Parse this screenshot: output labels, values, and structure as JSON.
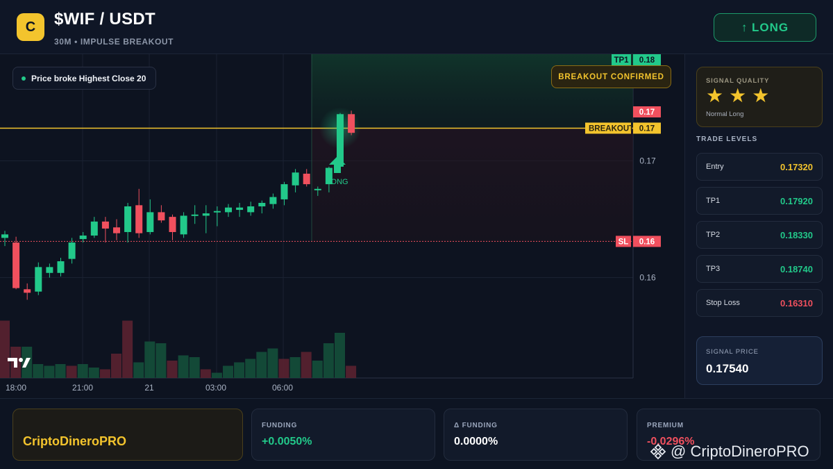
{
  "header": {
    "logo_letter": "C",
    "pair": "$WIF / USDT",
    "subtitle": "30M • IMPULSE BREAKOUT",
    "long_button": "↑ LONG"
  },
  "chart": {
    "signal_pill": "Price broke Highest Close 20",
    "confirm_badge": "BREAKOUT CONFIRMED",
    "long_marker_label": "LONG",
    "price_axis_labels": [
      "0.17",
      "0.16"
    ],
    "time_axis_labels": [
      "18:00",
      "21:00",
      "21",
      "03:00",
      "06:00"
    ],
    "tags": {
      "tp1_label": "TP1",
      "tp1_value": "0.18",
      "current_value": "0.17",
      "breakout_label": "BREAKOUT",
      "breakout_value": "0.17",
      "sl_label": "SL",
      "sl_value": "0.16"
    },
    "colors": {
      "up": "#22c98a",
      "down": "#f0505e",
      "breakout_line": "#f3c42d",
      "sl_line": "#f0505e"
    }
  },
  "chart_data": {
    "type": "candlestick",
    "ylim": [
      0.1555,
      0.18
    ],
    "levels": {
      "tp1": 0.1792,
      "breakout": 0.1728,
      "stop_loss": 0.1631,
      "entry": 0.1732
    },
    "candles": [
      {
        "o": 0.1634,
        "h": 0.164,
        "l": 0.1627,
        "c": 0.1637
      },
      {
        "o": 0.163,
        "h": 0.1635,
        "l": 0.159,
        "c": 0.1591
      },
      {
        "o": 0.159,
        "h": 0.1595,
        "l": 0.1581,
        "c": 0.1587
      },
      {
        "o": 0.1588,
        "h": 0.1613,
        "l": 0.1585,
        "c": 0.1609
      },
      {
        "o": 0.1604,
        "h": 0.1612,
        "l": 0.16,
        "c": 0.1609
      },
      {
        "o": 0.1604,
        "h": 0.1617,
        "l": 0.1601,
        "c": 0.1614
      },
      {
        "o": 0.1616,
        "h": 0.1634,
        "l": 0.1612,
        "c": 0.163
      },
      {
        "o": 0.1633,
        "h": 0.1639,
        "l": 0.163,
        "c": 0.1636
      },
      {
        "o": 0.1636,
        "h": 0.1652,
        "l": 0.1634,
        "c": 0.1648
      },
      {
        "o": 0.1648,
        "h": 0.1652,
        "l": 0.163,
        "c": 0.1642
      },
      {
        "o": 0.1643,
        "h": 0.165,
        "l": 0.1632,
        "c": 0.1638
      },
      {
        "o": 0.1639,
        "h": 0.1664,
        "l": 0.163,
        "c": 0.1661
      },
      {
        "o": 0.1662,
        "h": 0.1676,
        "l": 0.1634,
        "c": 0.1638
      },
      {
        "o": 0.1639,
        "h": 0.1667,
        "l": 0.1637,
        "c": 0.1656
      },
      {
        "o": 0.1656,
        "h": 0.1662,
        "l": 0.1647,
        "c": 0.1649
      },
      {
        "o": 0.1652,
        "h": 0.1654,
        "l": 0.1632,
        "c": 0.1639
      },
      {
        "o": 0.1637,
        "h": 0.1656,
        "l": 0.1634,
        "c": 0.1653
      },
      {
        "o": 0.1653,
        "h": 0.1662,
        "l": 0.1646,
        "c": 0.1654
      },
      {
        "o": 0.1653,
        "h": 0.1662,
        "l": 0.1638,
        "c": 0.1655
      },
      {
        "o": 0.1656,
        "h": 0.1661,
        "l": 0.1644,
        "c": 0.1657
      },
      {
        "o": 0.1656,
        "h": 0.1663,
        "l": 0.1652,
        "c": 0.166
      },
      {
        "o": 0.1658,
        "h": 0.1664,
        "l": 0.1652,
        "c": 0.166
      },
      {
        "o": 0.1656,
        "h": 0.1665,
        "l": 0.1653,
        "c": 0.1661
      },
      {
        "o": 0.1661,
        "h": 0.1666,
        "l": 0.1655,
        "c": 0.1664
      },
      {
        "o": 0.1663,
        "h": 0.1672,
        "l": 0.1659,
        "c": 0.1669
      },
      {
        "o": 0.1667,
        "h": 0.1682,
        "l": 0.1662,
        "c": 0.168
      },
      {
        "o": 0.1679,
        "h": 0.1693,
        "l": 0.1673,
        "c": 0.169
      },
      {
        "o": 0.1689,
        "h": 0.1693,
        "l": 0.1678,
        "c": 0.168
      },
      {
        "o": 0.1675,
        "h": 0.1678,
        "l": 0.167,
        "c": 0.1676
      },
      {
        "o": 0.168,
        "h": 0.1695,
        "l": 0.1673,
        "c": 0.1694
      },
      {
        "o": 0.1695,
        "h": 0.1741,
        "l": 0.169,
        "c": 0.174
      },
      {
        "o": 0.174,
        "h": 0.1743,
        "l": 0.1722,
        "c": 0.1724
      }
    ],
    "volumes": [
      0.66,
      0.36,
      0.36,
      0.16,
      0.14,
      0.16,
      0.14,
      0.16,
      0.12,
      0.1,
      0.28,
      0.66,
      0.18,
      0.42,
      0.4,
      0.2,
      0.26,
      0.24,
      0.1,
      0.06,
      0.14,
      0.18,
      0.22,
      0.3,
      0.34,
      0.22,
      0.24,
      0.3,
      0.2,
      0.4,
      0.52,
      0.14
    ],
    "volume_up": [
      false,
      false,
      true,
      true,
      true,
      true,
      false,
      true,
      true,
      false,
      false,
      false,
      true,
      true,
      true,
      false,
      true,
      true,
      false,
      true,
      true,
      true,
      true,
      true,
      true,
      false,
      true,
      false,
      true,
      true,
      true,
      false
    ]
  },
  "signal_quality": {
    "label": "SIGNAL QUALITY",
    "stars": 3,
    "description": "Normal Long"
  },
  "trade_levels": {
    "title": "TRADE LEVELS",
    "rows": [
      {
        "name": "Entry",
        "value": "0.17320",
        "color": "#f3c42d"
      },
      {
        "name": "TP1",
        "value": "0.17920",
        "color": "#22c98a"
      },
      {
        "name": "TP2",
        "value": "0.18330",
        "color": "#22c98a"
      },
      {
        "name": "TP3",
        "value": "0.18740",
        "color": "#22c98a"
      },
      {
        "name": "Stop Loss",
        "value": "0.16310",
        "color": "#f0505e"
      }
    ]
  },
  "signal_price": {
    "label": "SIGNAL PRICE",
    "value": "0.17540"
  },
  "footer": {
    "brand": "CriptoDineroPRO",
    "funding_label": "FUNDING",
    "funding_value": "+0.0050%",
    "delta_funding_label": "Δ FUNDING",
    "delta_funding_value": "0.0000%",
    "premium_label": "PREMIUM",
    "premium_value": "-0.0296%",
    "watermark": "@ CriptoDineroPRO"
  }
}
